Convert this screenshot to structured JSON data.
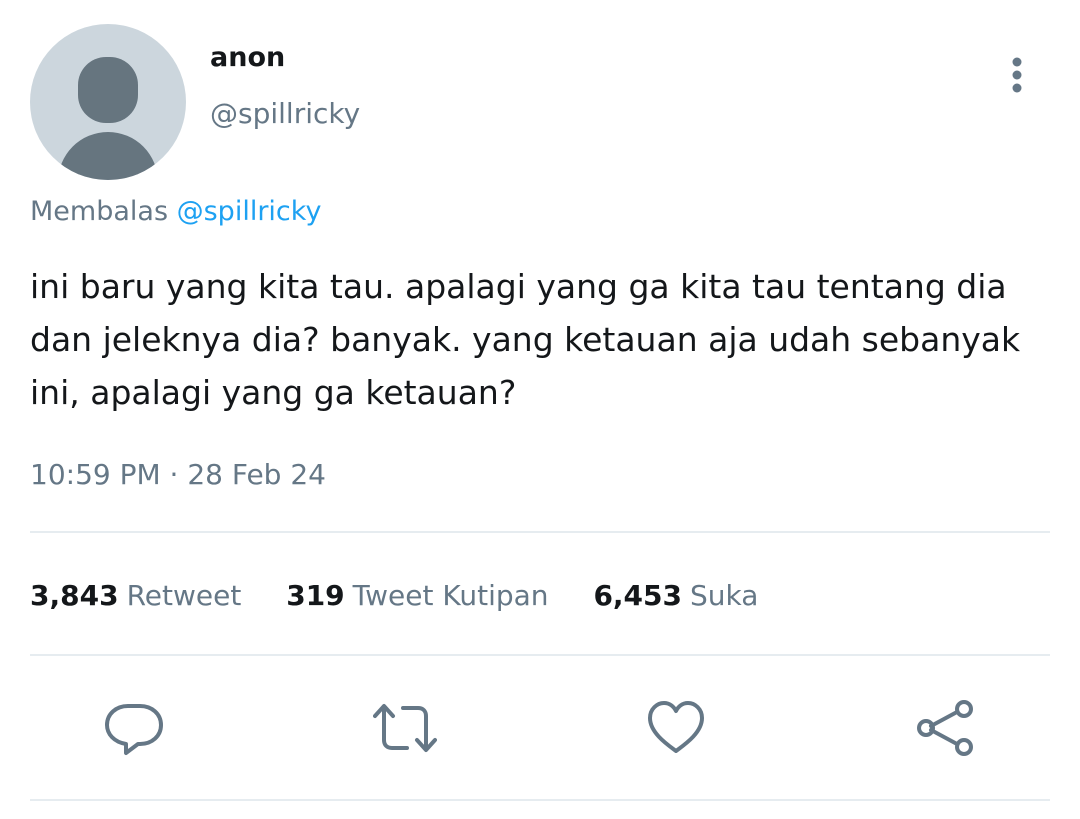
{
  "tweet": {
    "author": {
      "display_name": "anon",
      "handle": "@spillricky"
    },
    "reply_context": {
      "prefix": "Membalas",
      "mention": "@spillricky"
    },
    "text": "ini baru yang kita tau. apalagi yang ga kita tau tentang dia\ndan jeleknya dia? banyak. yang ketauan aja udah sebanyak\nini, apalagi yang ga ketauan?",
    "timestamp": "10:59 PM · 28 Feb 24"
  },
  "stats": {
    "retweets": {
      "count": "3,843",
      "label": "Retweet"
    },
    "quotes": {
      "count": "319",
      "label": "Tweet Kutipan"
    },
    "likes": {
      "count": "6,453",
      "label": "Suka"
    }
  },
  "actions": {
    "reply": {
      "icon": "reply-icon"
    },
    "retweet": {
      "icon": "retweet-icon"
    },
    "like": {
      "icon": "heart-icon"
    },
    "share": {
      "icon": "share-icon"
    }
  },
  "colors": {
    "text_primary": "#14171a",
    "text_secondary": "#657786",
    "link": "#1da1f2",
    "divider": "#e6ecf0",
    "avatar_bg": "#ccd6dd",
    "avatar_fg": "#66757f"
  }
}
